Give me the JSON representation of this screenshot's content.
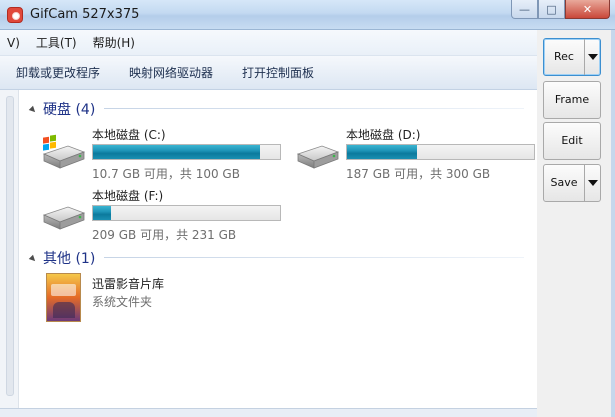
{
  "window": {
    "title": "GifCam 527x375",
    "minimize_glyph": "—",
    "maximize_glyph": "□",
    "close_glyph": "✕"
  },
  "menubar": {
    "items": [
      "V)",
      "工具(T)",
      "帮助(H)"
    ]
  },
  "commandbar": {
    "items": [
      "卸载或更改程序",
      "映射网络驱动器",
      "打开控制面板"
    ]
  },
  "groups": {
    "hard_disks": {
      "label": "硬盘 (4)",
      "drives": [
        {
          "name": "本地磁盘 (C:)",
          "info": "10.7 GB 可用，共 100 GB",
          "used_fraction": 0.893,
          "icon": "windows-drive-icon"
        },
        {
          "name": "本地磁盘 (D:)",
          "info": "187 GB 可用，共 300 GB",
          "used_fraction": 0.377,
          "icon": "hard-drive-icon"
        },
        {
          "name": "本地磁盘 (F:)",
          "info": "209 GB 可用，共 231 GB",
          "used_fraction": 0.095,
          "icon": "hard-drive-icon"
        }
      ]
    },
    "other": {
      "label": "其他 (1)",
      "items": [
        {
          "name": "迅雷影音片库",
          "type": "系统文件夹",
          "icon": "media-library-icon"
        }
      ]
    }
  },
  "gifcam": {
    "rec": "Rec",
    "frame": "Frame",
    "edit": "Edit",
    "save": "Save"
  },
  "colors": {
    "accent": "#1e3287",
    "bar_fill": "#1f95b8",
    "titlebar": "#c3d9f1"
  }
}
